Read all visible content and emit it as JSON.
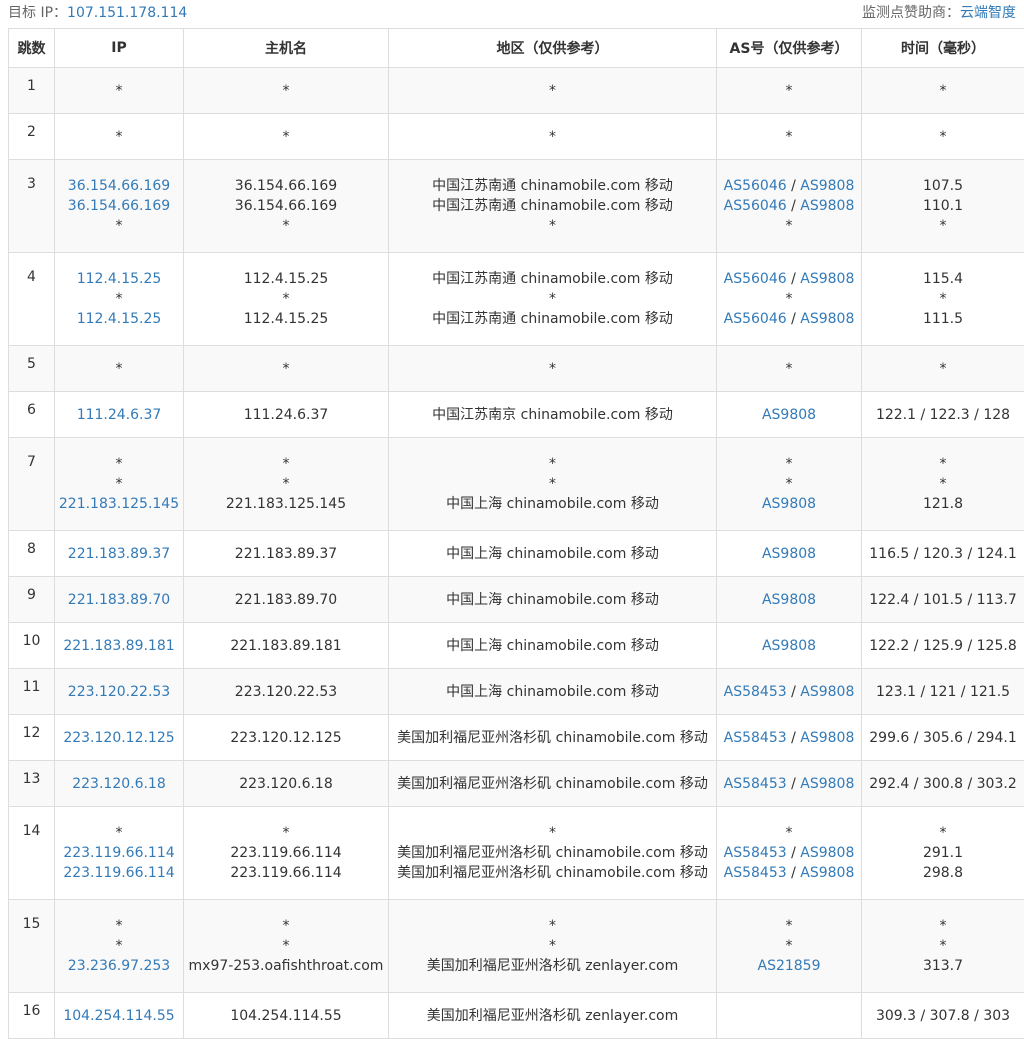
{
  "header": {
    "target_label": "目标 IP：",
    "target_ip": "107.151.178.114",
    "sponsor_label": "监测点赞助商：",
    "sponsor_name": "云端智度"
  },
  "columns": [
    "跳数",
    "IP",
    "主机名",
    "地区（仅供参考）",
    "AS号（仅供参考）",
    "时间（毫秒）"
  ],
  "rows": [
    {
      "hop": "1",
      "lines": [
        {
          "ip": "*",
          "host": "*",
          "region": "*",
          "as": [],
          "time": "*"
        }
      ]
    },
    {
      "hop": "2",
      "lines": [
        {
          "ip": "*",
          "host": "*",
          "region": "*",
          "as": [],
          "time": "*"
        }
      ]
    },
    {
      "hop": "3",
      "lines": [
        {
          "ip": "36.154.66.169",
          "host": "36.154.66.169",
          "region": "中国江苏南通 chinamobile.com 移动",
          "as": [
            "AS56046",
            "AS9808"
          ],
          "time": "107.5"
        },
        {
          "ip": "36.154.66.169",
          "host": "36.154.66.169",
          "region": "中国江苏南通 chinamobile.com 移动",
          "as": [
            "AS56046",
            "AS9808"
          ],
          "time": "110.1"
        },
        {
          "ip": "*",
          "host": "*",
          "region": "*",
          "as": [],
          "time": "*"
        }
      ]
    },
    {
      "hop": "4",
      "lines": [
        {
          "ip": "112.4.15.25",
          "host": "112.4.15.25",
          "region": "中国江苏南通 chinamobile.com 移动",
          "as": [
            "AS56046",
            "AS9808"
          ],
          "time": "115.4"
        },
        {
          "ip": "*",
          "host": "*",
          "region": "*",
          "as": [],
          "time": "*"
        },
        {
          "ip": "112.4.15.25",
          "host": "112.4.15.25",
          "region": "中国江苏南通 chinamobile.com 移动",
          "as": [
            "AS56046",
            "AS9808"
          ],
          "time": "111.5"
        }
      ]
    },
    {
      "hop": "5",
      "lines": [
        {
          "ip": "*",
          "host": "*",
          "region": "*",
          "as": [],
          "time": "*"
        }
      ]
    },
    {
      "hop": "6",
      "lines": [
        {
          "ip": "111.24.6.37",
          "host": "111.24.6.37",
          "region": "中国江苏南京 chinamobile.com 移动",
          "as": [
            "AS9808"
          ],
          "time": "122.1 / 122.3 / 128"
        }
      ]
    },
    {
      "hop": "7",
      "lines": [
        {
          "ip": "*",
          "host": "*",
          "region": "*",
          "as": [],
          "time": "*"
        },
        {
          "ip": "*",
          "host": "*",
          "region": "*",
          "as": [],
          "time": "*"
        },
        {
          "ip": "221.183.125.145",
          "host": "221.183.125.145",
          "region": "中国上海 chinamobile.com 移动",
          "as": [
            "AS9808"
          ],
          "time": "121.8"
        }
      ]
    },
    {
      "hop": "8",
      "lines": [
        {
          "ip": "221.183.89.37",
          "host": "221.183.89.37",
          "region": "中国上海 chinamobile.com 移动",
          "as": [
            "AS9808"
          ],
          "time": "116.5 / 120.3 / 124.1"
        }
      ]
    },
    {
      "hop": "9",
      "lines": [
        {
          "ip": "221.183.89.70",
          "host": "221.183.89.70",
          "region": "中国上海 chinamobile.com 移动",
          "as": [
            "AS9808"
          ],
          "time": "122.4 / 101.5 / 113.7"
        }
      ]
    },
    {
      "hop": "10",
      "lines": [
        {
          "ip": "221.183.89.181",
          "host": "221.183.89.181",
          "region": "中国上海 chinamobile.com 移动",
          "as": [
            "AS9808"
          ],
          "time": "122.2 / 125.9 / 125.8"
        }
      ]
    },
    {
      "hop": "11",
      "lines": [
        {
          "ip": "223.120.22.53",
          "host": "223.120.22.53",
          "region": "中国上海 chinamobile.com 移动",
          "as": [
            "AS58453",
            "AS9808"
          ],
          "time": "123.1 / 121 / 121.5"
        }
      ]
    },
    {
      "hop": "12",
      "lines": [
        {
          "ip": "223.120.12.125",
          "host": "223.120.12.125",
          "region": "美国加利福尼亚州洛杉矶 chinamobile.com 移动",
          "as": [
            "AS58453",
            "AS9808"
          ],
          "time": "299.6 / 305.6 / 294.1"
        }
      ]
    },
    {
      "hop": "13",
      "lines": [
        {
          "ip": "223.120.6.18",
          "host": "223.120.6.18",
          "region": "美国加利福尼亚州洛杉矶 chinamobile.com 移动",
          "as": [
            "AS58453",
            "AS9808"
          ],
          "time": "292.4 / 300.8 / 303.2"
        }
      ]
    },
    {
      "hop": "14",
      "lines": [
        {
          "ip": "*",
          "host": "*",
          "region": "*",
          "as": [],
          "time": "*"
        },
        {
          "ip": "223.119.66.114",
          "host": "223.119.66.114",
          "region": "美国加利福尼亚州洛杉矶 chinamobile.com 移动",
          "as": [
            "AS58453",
            "AS9808"
          ],
          "time": "291.1"
        },
        {
          "ip": "223.119.66.114",
          "host": "223.119.66.114",
          "region": "美国加利福尼亚州洛杉矶 chinamobile.com 移动",
          "as": [
            "AS58453",
            "AS9808"
          ],
          "time": "298.8"
        }
      ]
    },
    {
      "hop": "15",
      "lines": [
        {
          "ip": "*",
          "host": "*",
          "region": "*",
          "as": [],
          "time": "*"
        },
        {
          "ip": "*",
          "host": "*",
          "region": "*",
          "as": [],
          "time": "*"
        },
        {
          "ip": "23.236.97.253",
          "host": "mx97-253.oafishthroat.com",
          "region": "美国加利福尼亚州洛杉矶 zenlayer.com",
          "as": [
            "AS21859"
          ],
          "time": "313.7"
        }
      ]
    },
    {
      "hop": "16",
      "lines": [
        {
          "ip": "104.254.114.55",
          "host": "104.254.114.55",
          "region": "美国加利福尼亚州洛杉矶 zenlayer.com",
          "as": [],
          "time": "309.3 / 307.8 / 303"
        }
      ]
    }
  ]
}
